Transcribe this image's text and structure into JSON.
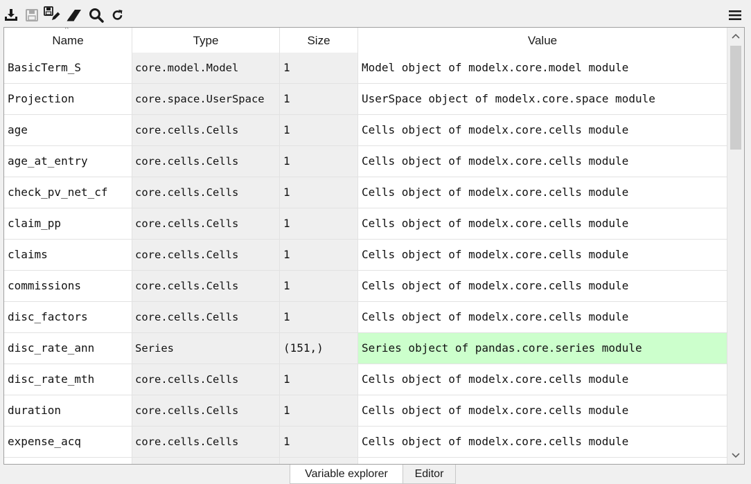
{
  "toolbar": {
    "icons": [
      "import-data-icon",
      "save-icon",
      "save-as-icon",
      "eraser-icon",
      "search-icon",
      "refresh-icon",
      "hamburger-menu-icon"
    ]
  },
  "table": {
    "columns": [
      "Name",
      "Type",
      "Size",
      "Value"
    ],
    "rows": [
      {
        "name": "BasicTerm_S",
        "type": "core.model.Model",
        "size": "1",
        "value": "Model object of modelx.core.model module"
      },
      {
        "name": "Projection",
        "type": "core.space.UserSpace",
        "size": "1",
        "value": "UserSpace object of modelx.core.space module"
      },
      {
        "name": "age",
        "type": "core.cells.Cells",
        "size": "1",
        "value": "Cells object of modelx.core.cells module"
      },
      {
        "name": "age_at_entry",
        "type": "core.cells.Cells",
        "size": "1",
        "value": "Cells object of modelx.core.cells module"
      },
      {
        "name": "check_pv_net_cf",
        "type": "core.cells.Cells",
        "size": "1",
        "value": "Cells object of modelx.core.cells module"
      },
      {
        "name": "claim_pp",
        "type": "core.cells.Cells",
        "size": "1",
        "value": "Cells object of modelx.core.cells module"
      },
      {
        "name": "claims",
        "type": "core.cells.Cells",
        "size": "1",
        "value": "Cells object of modelx.core.cells module"
      },
      {
        "name": "commissions",
        "type": "core.cells.Cells",
        "size": "1",
        "value": "Cells object of modelx.core.cells module"
      },
      {
        "name": "disc_factors",
        "type": "core.cells.Cells",
        "size": "1",
        "value": "Cells object of modelx.core.cells module"
      },
      {
        "name": "disc_rate_ann",
        "type": "Series",
        "size": "(151,)",
        "value": "Series object of pandas.core.series module"
      },
      {
        "name": "disc_rate_mth",
        "type": "core.cells.Cells",
        "size": "1",
        "value": "Cells object of modelx.core.cells module"
      },
      {
        "name": "duration",
        "type": "core.cells.Cells",
        "size": "1",
        "value": "Cells object of modelx.core.cells module"
      },
      {
        "name": "expense_acq",
        "type": "core.cells.Cells",
        "size": "1",
        "value": "Cells object of modelx.core.cells module"
      },
      {
        "name": "",
        "type": "",
        "size": "",
        "value": ""
      }
    ],
    "highlight_color": "#ccffcc",
    "highlighted_row": 9
  },
  "tabs": [
    {
      "label": "Variable explorer",
      "active": true
    },
    {
      "label": "Editor",
      "active": false
    }
  ]
}
